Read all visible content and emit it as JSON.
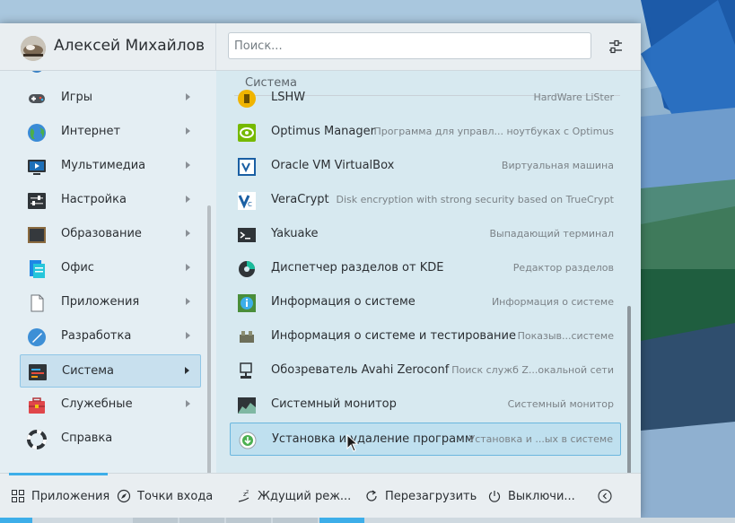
{
  "user": {
    "name": "Алексей Михайлов"
  },
  "search": {
    "placeholder": "Поиск..."
  },
  "categories": [
    {
      "label": "Игры",
      "icon": "gamepad-icon"
    },
    {
      "label": "Интернет",
      "icon": "globe-icon"
    },
    {
      "label": "Мультимедиа",
      "icon": "multimedia-icon"
    },
    {
      "label": "Настройка",
      "icon": "settings-icon"
    },
    {
      "label": "Образование",
      "icon": "education-icon"
    },
    {
      "label": "Офис",
      "icon": "office-icon"
    },
    {
      "label": "Приложения",
      "icon": "document-icon"
    },
    {
      "label": "Разработка",
      "icon": "development-icon"
    },
    {
      "label": "Система",
      "icon": "system-icon",
      "active": true
    },
    {
      "label": "Служебные",
      "icon": "toolbox-icon"
    },
    {
      "label": "Справка",
      "icon": "help-icon"
    }
  ],
  "apps_section": {
    "title": "Система"
  },
  "apps": [
    {
      "name": "LSHW",
      "desc": "HardWare LiSter",
      "icon": "lshw-icon"
    },
    {
      "name": "Optimus Manager",
      "desc": "Программа для управл... ноутбуках с Optimus",
      "icon": "nvidia-icon"
    },
    {
      "name": "Oracle VM VirtualBox",
      "desc": "Виртуальная машина",
      "icon": "virtualbox-icon"
    },
    {
      "name": "VeraCrypt",
      "desc": "Disk encryption with strong security based on TrueCrypt",
      "icon": "veracrypt-icon"
    },
    {
      "name": "Yakuake",
      "desc": "Выпадающий терминал",
      "icon": "terminal-icon"
    },
    {
      "name": "Диспетчер разделов от KDE",
      "desc": "Редактор разделов",
      "icon": "partition-icon"
    },
    {
      "name": "Информация о системе",
      "desc": "Информация о системе",
      "icon": "info-icon"
    },
    {
      "name": "Информация о системе и тестирование",
      "desc": "Показыв...системе",
      "icon": "hardinfo-icon"
    },
    {
      "name": "Обозреватель Avahi Zeroconf",
      "desc": "Поиск служб Z...окальной сети",
      "icon": "network-icon"
    },
    {
      "name": "Системный монитор",
      "desc": "Системный монитор",
      "icon": "monitor-icon"
    },
    {
      "name": "Установка и удаление программ",
      "desc": "Установка и ...ых в системе",
      "icon": "install-icon",
      "active": true
    }
  ],
  "footer": {
    "applications": "Приложения",
    "places": "Точки входа",
    "sleep": "Ждущий реж...",
    "restart": "Перезагрузить",
    "shutdown": "Выключи..."
  },
  "colors": {
    "accent": "#3daee9",
    "highlight": "#c8e0ee"
  }
}
